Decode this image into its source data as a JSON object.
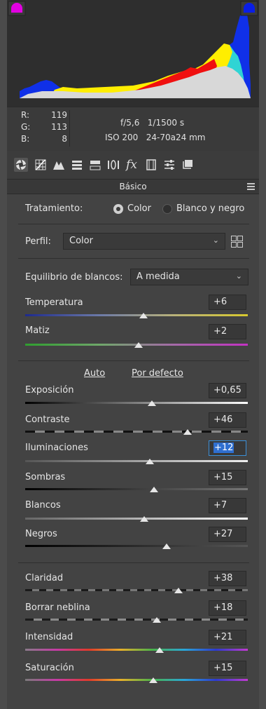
{
  "histogram": {
    "clip_shadow_color": "#e100e1",
    "clip_highlight_color": "#0a1ee6"
  },
  "readout": {
    "rgb": [
      {
        "label": "R:",
        "value": "119"
      },
      {
        "label": "G:",
        "value": "113"
      },
      {
        "label": "B:",
        "value": "8"
      }
    ],
    "aperture_shutter": "f/5,6   1/1500 s",
    "iso_lens": "ISO 200   24-70a24 mm"
  },
  "toolbar_icons": [
    "basic-panel-icon",
    "tone-curve-icon",
    "detail-icon",
    "hsl-icon",
    "split-toning-icon",
    "lens-corrections-icon",
    "effects-icon",
    "camera-calibration-icon",
    "presets-icon",
    "snapshots-icon"
  ],
  "panel": {
    "title": "Básico"
  },
  "treatment": {
    "label": "Tratamiento:",
    "option_color": "Color",
    "option_bw": "Blanco y negro"
  },
  "profile": {
    "label": "Perfil:",
    "value": "Color"
  },
  "white_balance": {
    "label": "Equilibrio de blancos:",
    "value": "A medida"
  },
  "links": {
    "auto": "Auto",
    "default": "Por defecto"
  },
  "sliders": [
    {
      "name": "temperature",
      "label": "Temperatura",
      "value": "+6",
      "pos": 0.53
    },
    {
      "name": "tint",
      "label": "Matiz",
      "value": "+2",
      "pos": 0.51
    },
    {
      "name": "exposure",
      "label": "Exposición",
      "value": "+0,65",
      "pos": 0.57
    },
    {
      "name": "contrast",
      "label": "Contraste",
      "value": "+46",
      "pos": 0.73
    },
    {
      "name": "highlights",
      "label": "Iluminaciones",
      "value": "+12",
      "pos": 0.56
    },
    {
      "name": "shadows",
      "label": "Sombras",
      "value": "+15",
      "pos": 0.58
    },
    {
      "name": "whites",
      "label": "Blancos",
      "value": "+7",
      "pos": 0.535
    },
    {
      "name": "blacks",
      "label": "Negros",
      "value": "+27",
      "pos": 0.635
    },
    {
      "name": "clarity",
      "label": "Claridad",
      "value": "+38",
      "pos": 0.69
    },
    {
      "name": "dehaze",
      "label": "Borrar neblina",
      "value": "+18",
      "pos": 0.59
    },
    {
      "name": "vibrance",
      "label": "Intensidad",
      "value": "+21",
      "pos": 0.605
    },
    {
      "name": "saturation",
      "label": "Saturación",
      "value": "+15",
      "pos": 0.575
    }
  ]
}
